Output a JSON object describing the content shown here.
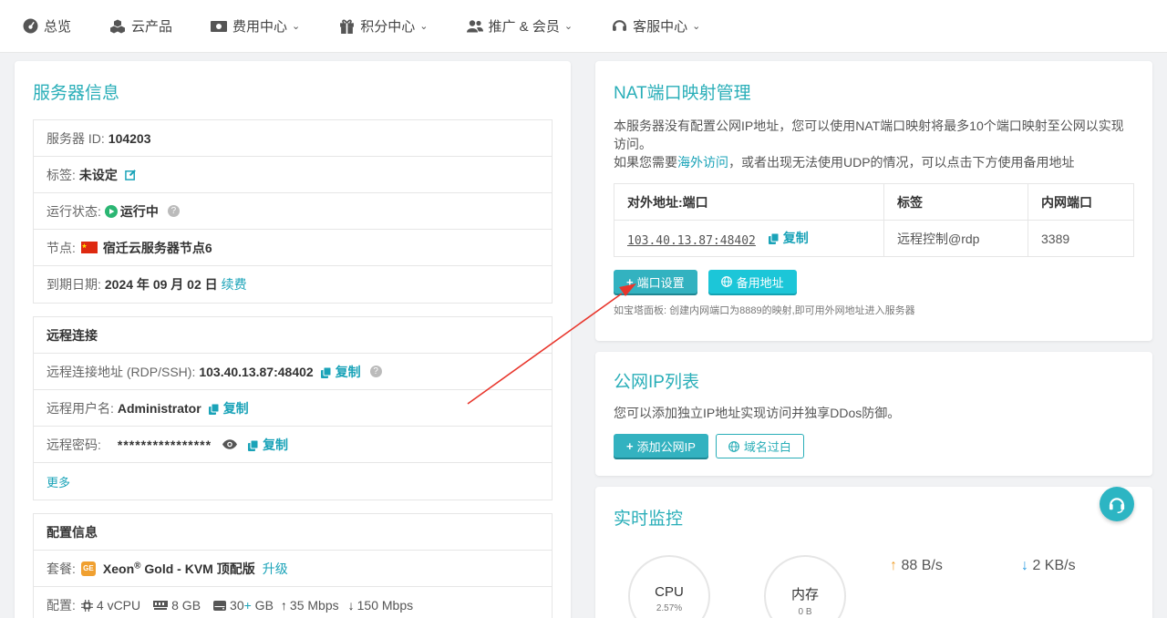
{
  "nav": {
    "overview": "总览",
    "cloud_products": "云产品",
    "billing": "费用中心",
    "points": "积分中心",
    "promotion": "推广 & 会员",
    "support": "客服中心"
  },
  "server_info": {
    "title": "服务器信息",
    "id_label": "服务器 ID:",
    "id_value": "104203",
    "tag_label": "标签:",
    "tag_value": "未设定",
    "status_label": "运行状态:",
    "status_value": "运行中",
    "node_label": "节点:",
    "node_value": "宿迁云服务器节点6",
    "expire_label": "到期日期:",
    "expire_value": "2024 年 09 月 02 日",
    "renew": "续费"
  },
  "remote": {
    "title": "远程连接",
    "addr_label": "远程连接地址 (RDP/SSH):",
    "addr_value": "103.40.13.87:48402",
    "user_label": "远程用户名:",
    "user_value": "Administrator",
    "pwd_label": "远程密码:",
    "pwd_value": "****************",
    "copy": "复制",
    "more": "更多"
  },
  "config": {
    "title": "配置信息",
    "plan_label": "套餐:",
    "plan_badge": "GE",
    "plan_value_a": "Xeon",
    "plan_value_sup": "®",
    "plan_value_b": " Gold - KVM 顶配版",
    "upgrade": "升级",
    "spec_label": "配置:",
    "cpu": "4 vCPU",
    "ram": "8 GB",
    "disk_a": "30",
    "disk_plus": "+",
    "disk_b": " GB",
    "up_bw": "35 Mbps",
    "down_bw": "150 Mbps"
  },
  "nat": {
    "title": "NAT端口映射管理",
    "desc1": "本服务器没有配置公网IP地址，您可以使用NAT端口映射将最多10个端口映射至公网以实现访问。",
    "desc2_a": "如果您需要",
    "desc2_link": "海外访问",
    "desc2_b": "，或者出现无法使用UDP的情况，可以点击下方使用备用地址",
    "headers": [
      "对外地址:端口",
      "标签",
      "内网端口"
    ],
    "row": {
      "addr": "103.40.13.87:48402",
      "copy": "复制",
      "tag": "远程控制@rdp",
      "port": "3389"
    },
    "btn_port": "端口设置",
    "btn_backup": "备用地址",
    "hint": "如宝塔面板: 创建内网端口为8889的映射,即可用外网地址进入服务器"
  },
  "public_ip": {
    "title": "公网IP列表",
    "desc": "您可以添加独立IP地址实现访问并独享DDos防御。",
    "btn_add": "添加公网IP",
    "btn_whitelist": "域名过白"
  },
  "monitor": {
    "title": "实时监控",
    "cpu_label": "CPU",
    "cpu_value": "2.57%",
    "mem_label": "内存",
    "mem_value": "0 B",
    "up": "88 B/s",
    "down": "2 KB/s"
  },
  "colors": {
    "accent": "#29aeb8",
    "link": "#1aa3b8",
    "up_arrow": "#f0a030",
    "down_arrow": "#2a9be0",
    "arrow_annotation": "#e8362c"
  }
}
